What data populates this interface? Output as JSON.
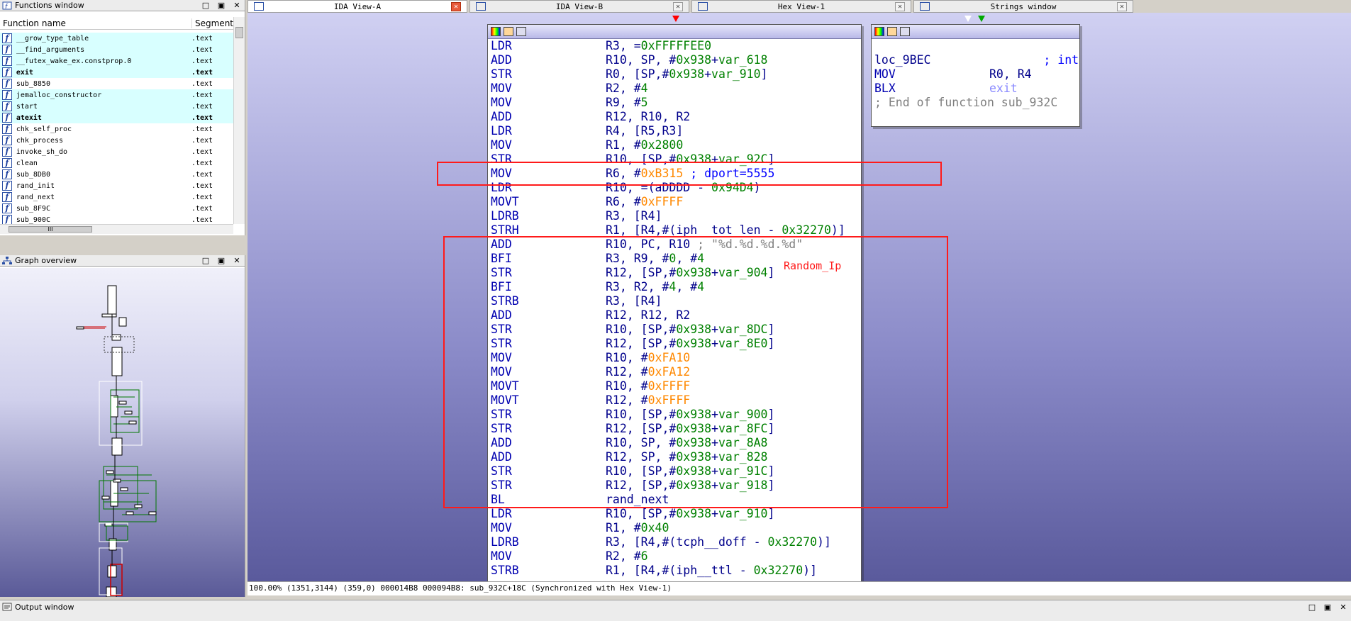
{
  "functions_window": {
    "title": "Functions window",
    "col_name": "Function name",
    "col_segment": "Segment",
    "rows": [
      {
        "name": "__grow_type_table",
        "segment": ".text",
        "hl": true,
        "bold": false
      },
      {
        "name": "__find_arguments",
        "segment": ".text",
        "hl": true,
        "bold": false
      },
      {
        "name": "__futex_wake_ex.constprop.0",
        "segment": ".text",
        "hl": true,
        "bold": false
      },
      {
        "name": "exit",
        "segment": ".text",
        "hl": true,
        "bold": true
      },
      {
        "name": "sub_8850",
        "segment": ".text",
        "hl": false,
        "bold": false
      },
      {
        "name": "jemalloc_constructor",
        "segment": ".text",
        "hl": true,
        "bold": false
      },
      {
        "name": "start",
        "segment": ".text",
        "hl": true,
        "bold": false
      },
      {
        "name": "atexit",
        "segment": ".text",
        "hl": true,
        "bold": true
      },
      {
        "name": "chk_self_proc",
        "segment": ".text",
        "hl": false,
        "bold": false
      },
      {
        "name": "chk_process",
        "segment": ".text",
        "hl": false,
        "bold": false
      },
      {
        "name": "invoke_sh_do",
        "segment": ".text",
        "hl": false,
        "bold": false
      },
      {
        "name": "clean",
        "segment": ".text",
        "hl": false,
        "bold": false
      },
      {
        "name": "sub_8DB0",
        "segment": ".text",
        "hl": false,
        "bold": false
      },
      {
        "name": "rand_init",
        "segment": ".text",
        "hl": false,
        "bold": false
      },
      {
        "name": "rand_next",
        "segment": ".text",
        "hl": false,
        "bold": false
      },
      {
        "name": "sub_8F9C",
        "segment": ".text",
        "hl": false,
        "bold": false
      },
      {
        "name": "sub_900C",
        "segment": ".text",
        "hl": false,
        "bold": false
      }
    ],
    "scroll_grip": "III"
  },
  "graph_overview": {
    "title": "Graph overview"
  },
  "window_controls": {
    "minimize": "□",
    "restore": "▣",
    "close": "✕"
  },
  "tabs": [
    {
      "label": "IDA View-A",
      "active": true
    },
    {
      "label": "IDA View-B",
      "active": false
    },
    {
      "label": "Hex View-1",
      "active": false
    },
    {
      "label": "Strings window",
      "active": false
    }
  ],
  "main_node": {
    "lines": [
      [
        [
          "LDR",
          "mn"
        ],
        [
          "R3, =",
          "ops"
        ],
        [
          "0xFFFFFEE0",
          "num"
        ]
      ],
      [
        [
          "ADD",
          "mn"
        ],
        [
          "R10, SP, #",
          "ops"
        ],
        [
          "0x938",
          "num"
        ],
        [
          "+",
          "ops"
        ],
        [
          "var_618",
          "num"
        ]
      ],
      [
        [
          "STR",
          "mn"
        ],
        [
          "R0, [SP,#",
          "ops"
        ],
        [
          "0x938",
          "num"
        ],
        [
          "+",
          "ops"
        ],
        [
          "var_910",
          "num"
        ],
        [
          "]",
          "ops"
        ]
      ],
      [
        [
          "MOV",
          "mn"
        ],
        [
          "R2, #",
          "ops"
        ],
        [
          "4",
          "num"
        ]
      ],
      [
        [
          "MOV",
          "mn"
        ],
        [
          "R9, #",
          "ops"
        ],
        [
          "5",
          "num"
        ]
      ],
      [
        [
          "ADD",
          "mn"
        ],
        [
          "R12, R10, R2",
          "ops"
        ]
      ],
      [
        [
          "LDR",
          "mn"
        ],
        [
          "R4, [R5,R3]",
          "ops"
        ]
      ],
      [
        [
          "MOV",
          "mn"
        ],
        [
          "R1, #",
          "ops"
        ],
        [
          "0x2800",
          "num"
        ]
      ],
      [
        [
          "STR",
          "mn"
        ],
        [
          "R10, [SP,#",
          "ops"
        ],
        [
          "0x938",
          "num"
        ],
        [
          "+",
          "ops"
        ],
        [
          "var_92C",
          "num"
        ],
        [
          "]",
          "ops"
        ]
      ],
      [
        [
          "MOV",
          "mn"
        ],
        [
          "R6, #",
          "ops"
        ],
        [
          "0xB315",
          "imm"
        ],
        [
          " ; dport=5555",
          "cmt-blue"
        ]
      ],
      [
        [
          "LDR",
          "mn"
        ],
        [
          "R10, =(aDDDD - ",
          "ops"
        ],
        [
          "0x94D4",
          "num"
        ],
        [
          ")",
          "ops"
        ]
      ],
      [
        [
          "MOVT",
          "mn"
        ],
        [
          "R6, #",
          "ops"
        ],
        [
          "0xFFFF",
          "imm"
        ]
      ],
      [
        [
          "LDRB",
          "mn"
        ],
        [
          "R3, [R4]",
          "ops"
        ]
      ],
      [
        [
          "STRH",
          "mn"
        ],
        [
          "R1, [R4,#(iph__tot_len - ",
          "ops"
        ],
        [
          "0x32270",
          "num"
        ],
        [
          ")]",
          "ops"
        ]
      ],
      [
        [
          "ADD",
          "mn"
        ],
        [
          "R10, PC, R10 ",
          "ops"
        ],
        [
          "; \"%d.%d.%d.%d\"",
          "cmt"
        ]
      ],
      [
        [
          "BFI",
          "mn"
        ],
        [
          "R3, R9, #",
          "ops"
        ],
        [
          "0",
          "num"
        ],
        [
          ", #",
          "ops"
        ],
        [
          "4",
          "num"
        ]
      ],
      [
        [
          "STR",
          "mn"
        ],
        [
          "R12, [SP,#",
          "ops"
        ],
        [
          "0x938",
          "num"
        ],
        [
          "+",
          "ops"
        ],
        [
          "var_904",
          "num"
        ],
        [
          "]",
          "ops"
        ]
      ],
      [
        [
          "BFI",
          "mn"
        ],
        [
          "R3, R2, #",
          "ops"
        ],
        [
          "4",
          "num"
        ],
        [
          ", #",
          "ops"
        ],
        [
          "4",
          "num"
        ]
      ],
      [
        [
          "STRB",
          "mn"
        ],
        [
          "R3, [R4]",
          "ops"
        ]
      ],
      [
        [
          "ADD",
          "mn"
        ],
        [
          "R12, R12, R2",
          "ops"
        ]
      ],
      [
        [
          "STR",
          "mn"
        ],
        [
          "R10, [SP,#",
          "ops"
        ],
        [
          "0x938",
          "num"
        ],
        [
          "+",
          "ops"
        ],
        [
          "var_8DC",
          "num"
        ],
        [
          "]",
          "ops"
        ]
      ],
      [
        [
          "STR",
          "mn"
        ],
        [
          "R12, [SP,#",
          "ops"
        ],
        [
          "0x938",
          "num"
        ],
        [
          "+",
          "ops"
        ],
        [
          "var_8E0",
          "num"
        ],
        [
          "]",
          "ops"
        ]
      ],
      [
        [
          "MOV",
          "mn"
        ],
        [
          "R10, #",
          "ops"
        ],
        [
          "0xFA10",
          "imm"
        ]
      ],
      [
        [
          "MOV",
          "mn"
        ],
        [
          "R12, #",
          "ops"
        ],
        [
          "0xFA12",
          "imm"
        ]
      ],
      [
        [
          "MOVT",
          "mn"
        ],
        [
          "R10, #",
          "ops"
        ],
        [
          "0xFFFF",
          "imm"
        ]
      ],
      [
        [
          "MOVT",
          "mn"
        ],
        [
          "R12, #",
          "ops"
        ],
        [
          "0xFFFF",
          "imm"
        ]
      ],
      [
        [
          "STR",
          "mn"
        ],
        [
          "R10, [SP,#",
          "ops"
        ],
        [
          "0x938",
          "num"
        ],
        [
          "+",
          "ops"
        ],
        [
          "var_900",
          "num"
        ],
        [
          "]",
          "ops"
        ]
      ],
      [
        [
          "STR",
          "mn"
        ],
        [
          "R12, [SP,#",
          "ops"
        ],
        [
          "0x938",
          "num"
        ],
        [
          "+",
          "ops"
        ],
        [
          "var_8FC",
          "num"
        ],
        [
          "]",
          "ops"
        ]
      ],
      [
        [
          "ADD",
          "mn"
        ],
        [
          "R10, SP, #",
          "ops"
        ],
        [
          "0x938",
          "num"
        ],
        [
          "+",
          "ops"
        ],
        [
          "var_8A8",
          "num"
        ]
      ],
      [
        [
          "ADD",
          "mn"
        ],
        [
          "R12, SP, #",
          "ops"
        ],
        [
          "0x938",
          "num"
        ],
        [
          "+",
          "ops"
        ],
        [
          "var_828",
          "num"
        ]
      ],
      [
        [
          "STR",
          "mn"
        ],
        [
          "R10, [SP,#",
          "ops"
        ],
        [
          "0x938",
          "num"
        ],
        [
          "+",
          "ops"
        ],
        [
          "var_91C",
          "num"
        ],
        [
          "]",
          "ops"
        ]
      ],
      [
        [
          "STR",
          "mn"
        ],
        [
          "R12, [SP,#",
          "ops"
        ],
        [
          "0x938",
          "num"
        ],
        [
          "+",
          "ops"
        ],
        [
          "var_918",
          "num"
        ],
        [
          "]",
          "ops"
        ]
      ],
      [
        [
          "BL",
          "mn"
        ],
        [
          "rand_next",
          "ops"
        ]
      ],
      [
        [
          "LDR",
          "mn"
        ],
        [
          "R10, [SP,#",
          "ops"
        ],
        [
          "0x938",
          "num"
        ],
        [
          "+",
          "ops"
        ],
        [
          "var_910",
          "num"
        ],
        [
          "]",
          "ops"
        ]
      ],
      [
        [
          "MOV",
          "mn"
        ],
        [
          "R1, #",
          "ops"
        ],
        [
          "0x40",
          "num"
        ]
      ],
      [
        [
          "LDRB",
          "mn"
        ],
        [
          "R3, [R4,#(tcph__doff - ",
          "ops"
        ],
        [
          "0x32270",
          "num"
        ],
        [
          ")]",
          "ops"
        ]
      ],
      [
        [
          "MOV",
          "mn"
        ],
        [
          "R2, #",
          "ops"
        ],
        [
          "6",
          "num"
        ]
      ],
      [
        [
          "STRB",
          "mn"
        ],
        [
          "R1, [R4,#(iph__ttl - ",
          "ops"
        ],
        [
          "0x32270",
          "num"
        ],
        [
          ")]",
          "ops"
        ]
      ]
    ]
  },
  "side_node": {
    "lines": [
      [
        [
          "",
          "ops"
        ]
      ],
      [
        [
          "loc_9BEC",
          "lbl"
        ],
        [
          "                ; int",
          "cmt-blue"
        ]
      ],
      [
        [
          "MOV",
          "mn"
        ],
        [
          "R0, R4",
          "ops"
        ]
      ],
      [
        [
          "BLX",
          "mn"
        ],
        [
          "exit",
          "gray-blue"
        ]
      ],
      [
        [
          "; End of function sub_932C",
          "cmt"
        ]
      ]
    ]
  },
  "annotation": "Random_Ip",
  "status_bar": "100.00% (1351,3144) (359,0) 000014B8 000094B8: sub_932C+18C (Synchronized with Hex View-1)",
  "output_window": {
    "title": "Output window"
  }
}
